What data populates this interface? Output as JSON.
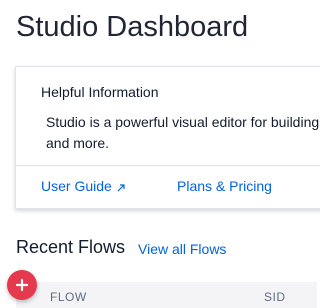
{
  "page": {
    "title": "Studio Dashboard"
  },
  "info_card": {
    "title": "Helpful Information",
    "body": "Studio is a powerful visual editor for building and more.",
    "links": {
      "user_guide": "User Guide",
      "plans_pricing": "Plans & Pricing"
    }
  },
  "recent_flows": {
    "heading": "Recent Flows",
    "view_all": "View all Flows",
    "columns": [
      "FLOW",
      "SID"
    ]
  },
  "icons": {
    "external_link": "external-link-icon",
    "add": "plus-icon"
  },
  "colors": {
    "link": "#0263e0",
    "add_button": "#e5394d",
    "table_header_bg": "#f4f4f6"
  }
}
